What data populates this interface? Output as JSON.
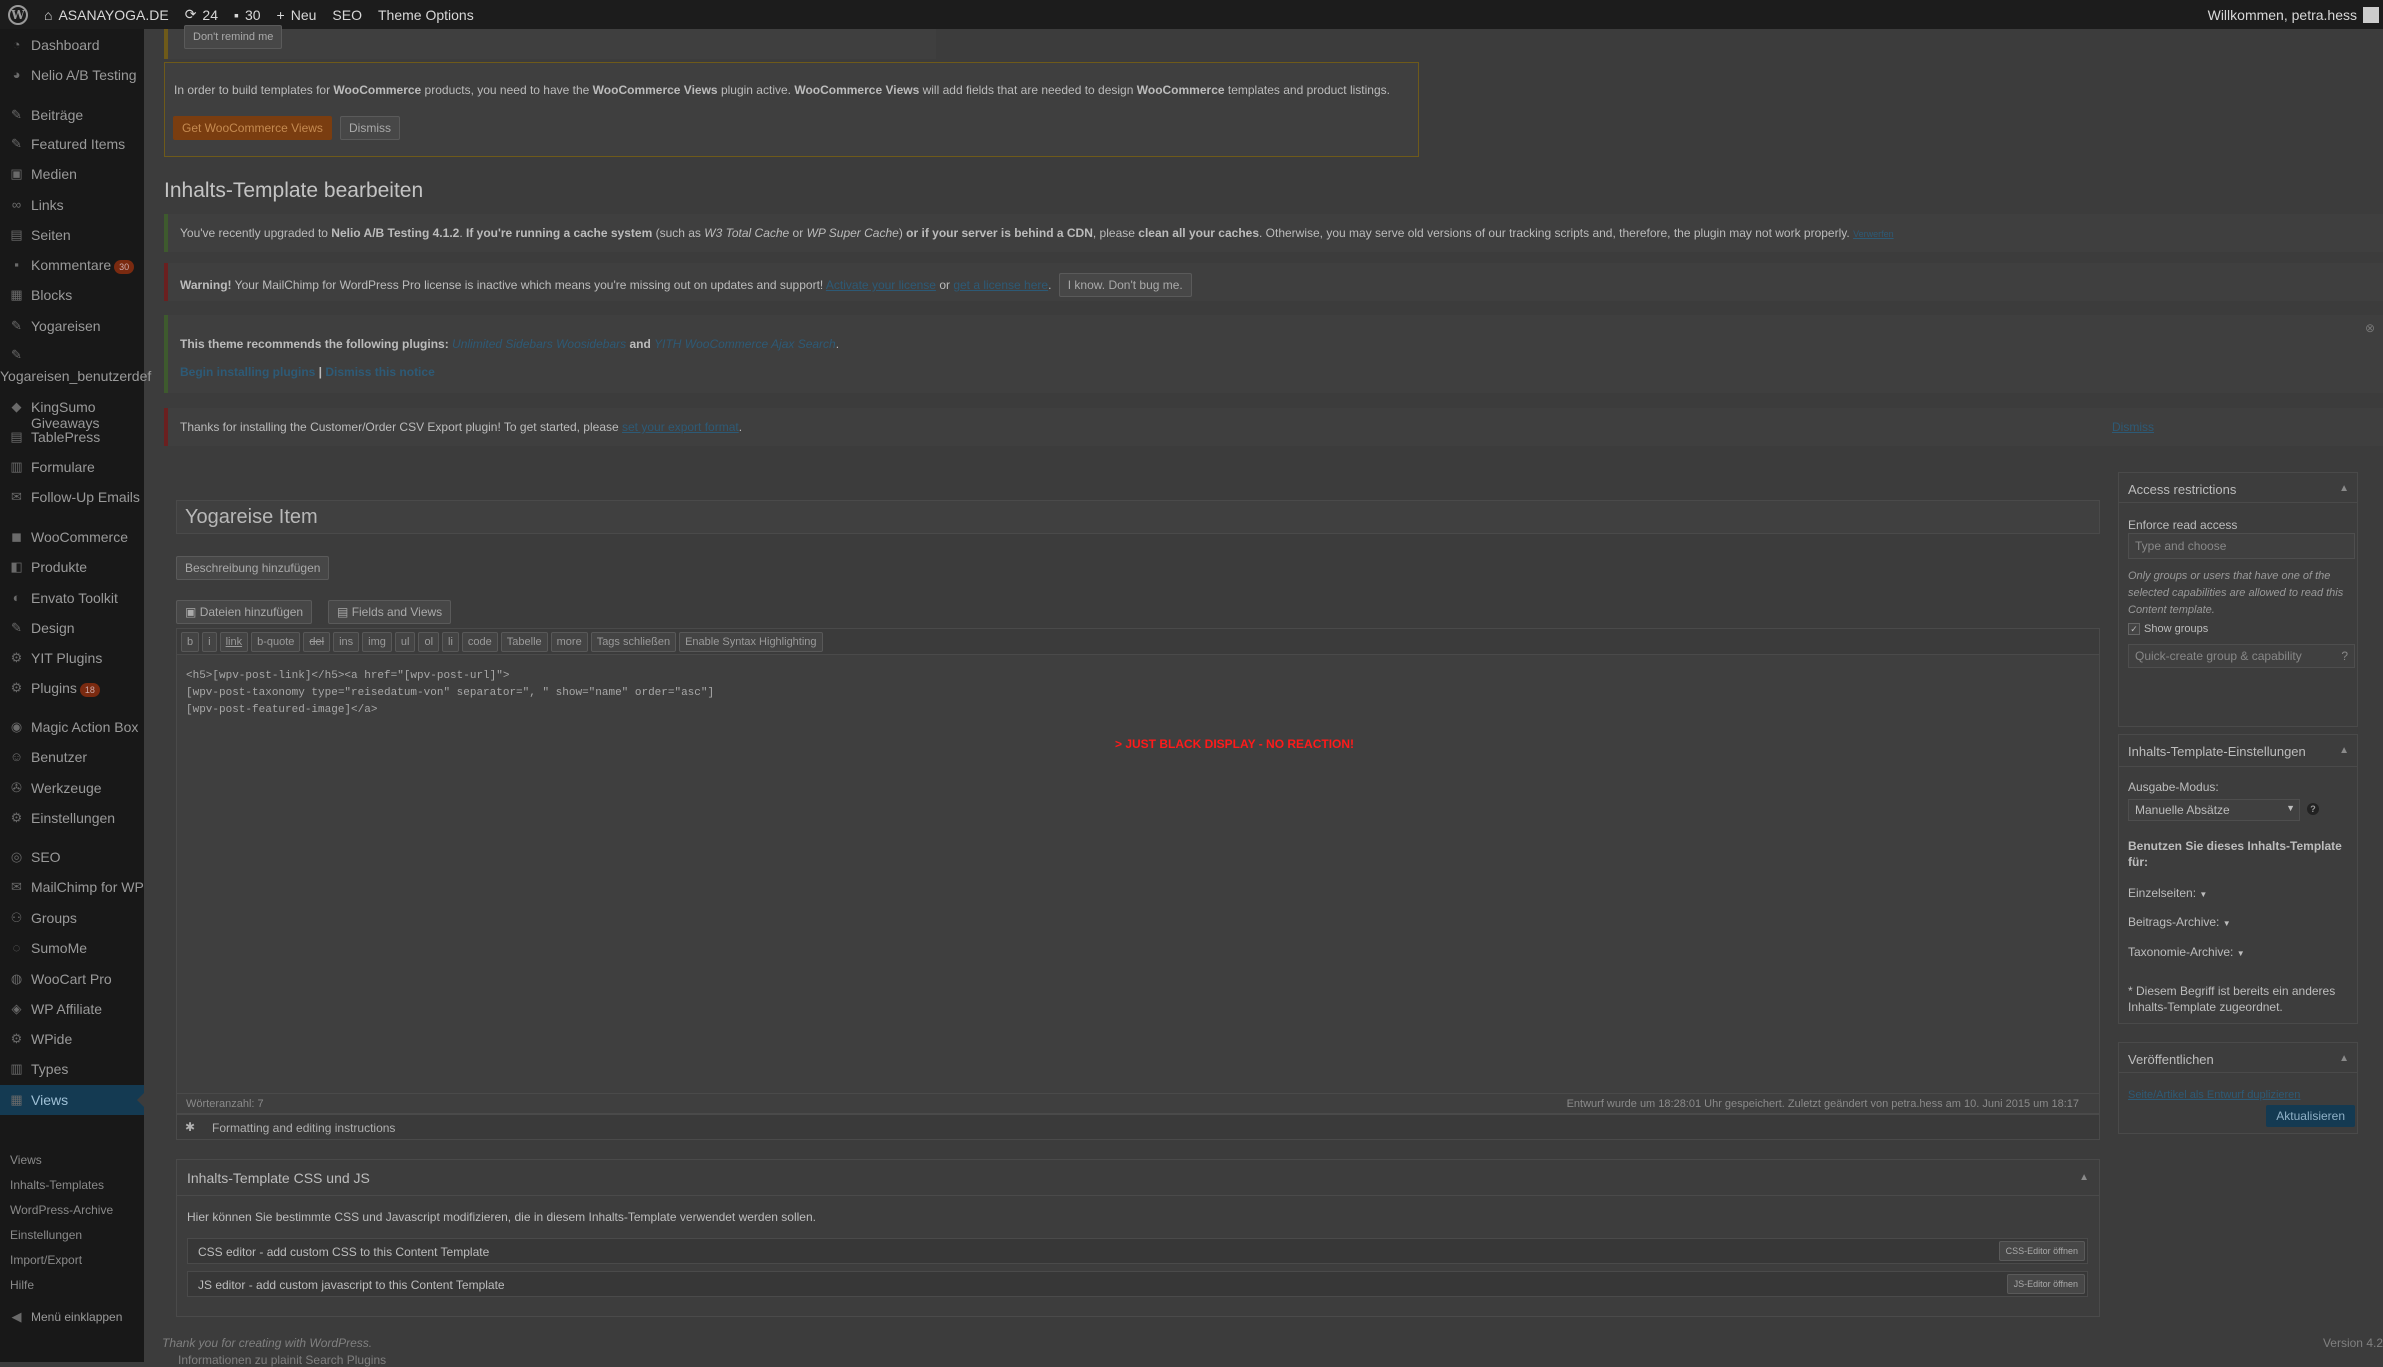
{
  "adminbar": {
    "site_name": "ASANAYOGA.DE",
    "updates_count": "24",
    "comments_count": "30",
    "new_label": "Neu",
    "seo_label": "SEO",
    "theme_options_label": "Theme Options",
    "greeting": "Willkommen, petra.hess"
  },
  "sidebar": {
    "items": [
      {
        "label": "Dashboard",
        "icon": "dashboard-icon"
      },
      {
        "label": "Nelio A/B Testing",
        "icon": "nelio-icon"
      },
      {
        "label": "Beiträge",
        "icon": "pin-icon"
      },
      {
        "label": "Featured Items",
        "icon": "pin-icon"
      },
      {
        "label": "Medien",
        "icon": "media-icon"
      },
      {
        "label": "Links",
        "icon": "link-icon"
      },
      {
        "label": "Seiten",
        "icon": "page-icon"
      },
      {
        "label": "Kommentare",
        "icon": "comment-icon",
        "count": "30"
      },
      {
        "label": "Blocks",
        "icon": "block-icon"
      },
      {
        "label": "Yogareisen",
        "icon": "pin-icon"
      },
      {
        "label": "Yogareisen_benutzerdef",
        "icon": "pin-icon"
      },
      {
        "label": "KingSumo Giveaways",
        "icon": "gift-icon"
      },
      {
        "label": "TablePress",
        "icon": "table-icon"
      },
      {
        "label": "Formulare",
        "icon": "form-icon"
      },
      {
        "label": "Follow-Up Emails",
        "icon": "mail-icon"
      },
      {
        "label": "WooCommerce",
        "icon": "woo-icon"
      },
      {
        "label": "Produkte",
        "icon": "product-icon"
      },
      {
        "label": "Envato Toolkit",
        "icon": "envato-icon"
      },
      {
        "label": "Design",
        "icon": "brush-icon"
      },
      {
        "label": "YIT Plugins",
        "icon": "plugin-icon"
      },
      {
        "label": "Plugins",
        "icon": "plugin-icon",
        "count": "18"
      },
      {
        "label": "Magic Action Box",
        "icon": "box-icon"
      },
      {
        "label": "Benutzer",
        "icon": "user-icon"
      },
      {
        "label": "Werkzeuge",
        "icon": "wrench-icon"
      },
      {
        "label": "Einstellungen",
        "icon": "settings-icon"
      },
      {
        "label": "SEO",
        "icon": "seo-icon"
      },
      {
        "label": "MailChimp for WP",
        "icon": "mailchimp-icon"
      },
      {
        "label": "Groups",
        "icon": "groups-icon"
      },
      {
        "label": "SumoMe",
        "icon": "sumome-icon"
      },
      {
        "label": "WooCart Pro",
        "icon": "cart-icon"
      },
      {
        "label": "WP Affiliate",
        "icon": "affiliate-icon"
      },
      {
        "label": "WPide",
        "icon": "code-icon"
      },
      {
        "label": "Types",
        "icon": "types-icon"
      },
      {
        "label": "Views",
        "icon": "views-icon"
      }
    ],
    "submenu": [
      "Views",
      "Inhalts-Templates",
      "WordPress-Archive",
      "Einstellungen",
      "Import/Export",
      "Hilfe"
    ],
    "collapse_label": "Menü einklappen"
  },
  "notices": {
    "remind": "Don't remind me",
    "woo": {
      "text_1": "In order to build templates for ",
      "woo_a": "WooCommerce",
      "text_2": " products, you need to have the ",
      "views_a": "WooCommerce Views",
      "text_3": " plugin active.  ",
      "views_b": "WooCommerce Views",
      "text_4": " will add fields that are needed to design ",
      "woo_b": "WooCommerce",
      "text_5": " templates and product listings.",
      "get_button": "Get WooCommerce Views",
      "dismiss_button": "Dismiss"
    },
    "page_title": "Inhalts-Template bearbeiten",
    "nelio": {
      "t1": "You've recently upgraded to ",
      "b1": "Nelio A/B Testing 4.1.2",
      "t2": ". ",
      "b2": "If you're running a cache system",
      "t3": " (such as ",
      "i1": "W3 Total Cache",
      "t4": " or ",
      "i2": "WP Super Cache",
      "t5": ") ",
      "b3": "or if your server is behind a CDN",
      "t6": ", please ",
      "b4": "clean all your caches",
      "t7": ". Otherwise, you may serve old versions of our tracking scripts and, therefore, the plugin may not work properly.",
      "dismiss": "Verwerfen"
    },
    "mailchimp": {
      "warning": "Warning!",
      "t1": " Your MailChimp for WordPress Pro license is inactive which means you're missing out on updates and support! ",
      "activate": "Activate your license",
      "t2": " or ",
      "get": "get a license here",
      "t3": ".",
      "button": "I know. Don't bug me."
    },
    "theme": {
      "t1": "This theme recommends the following plugins: ",
      "p1": "Unlimited Sidebars Woosidebars",
      "t2": " and ",
      "p2": "YITH WooCommerce Ajax Search",
      "t3": ".",
      "begin": "Begin installing plugins",
      "sep": " | ",
      "dismiss": "Dismiss this notice"
    },
    "csv": {
      "t1": "Thanks for installing the Customer/Order CSV Export plugin! To get started, please ",
      "link": "set your export format",
      "t2": ".",
      "dismiss": "Dismiss"
    }
  },
  "editor": {
    "title_value": "Yogareise Item",
    "description_button": "Beschreibung hinzufügen",
    "media_button": "Dateien hinzufügen",
    "fields_button": "Fields and Views",
    "quicktags": [
      "b",
      "i",
      "link",
      "b-quote",
      "del",
      "ins",
      "img",
      "ul",
      "ol",
      "li",
      "code",
      "Tabelle",
      "more",
      "Tags schließen",
      "Enable Syntax Highlighting"
    ],
    "code_lines": [
      "<h5>[wpv-post-link]</h5><a href=\"[wpv-post-url]\">",
      "",
      "[wpv-post-taxonomy type=\"reisedatum-von\" separator=\", \" show=\"name\" order=\"asc\"]",
      "[wpv-post-featured-image]</a>"
    ],
    "overlay_warning": "> JUST BLACK DISPLAY - NO REACTION!",
    "word_count": "Wörteranzahl: 7",
    "status": "Entwurf wurde um 18:28:01 Uhr gespeichert. Zuletzt geändert von petra.hess am 10. Juni 2015 um 18:17",
    "formatting": "Formatting and editing instructions"
  },
  "css_js": {
    "title": "Inhalts-Template CSS und JS",
    "desc": "Hier können Sie bestimmte CSS und Javascript modifizieren, die in diesem Inhalts-Template verwendet werden sollen.",
    "css_label": "CSS editor - add custom CSS to this Content Template",
    "css_button": "CSS-Editor öffnen",
    "js_label": "JS editor - add custom javascript to this Content Template",
    "js_button": "JS-Editor öffnen"
  },
  "access": {
    "title": "Access restrictions",
    "enforce": "Enforce read access",
    "placeholder": "Type and choose",
    "desc": "Only groups or users that have one of the selected capabilities are allowed to read this Content template.",
    "show_groups": "Show groups",
    "quick_create": "Quick-create group & capability",
    "help": "?"
  },
  "template_settings": {
    "title": "Inhalts-Template-Einstellungen",
    "mode_label": "Ausgabe-Modus:",
    "mode_value": "Manuelle Absätze",
    "help": "?",
    "use_for": "Benutzen Sie dieses Inhalts-Template für:",
    "single": "Einzelseiten:",
    "archives": "Beitrags-Archive:",
    "taxonomy": "Taxonomie-Archive:",
    "note": "* Diesem Begriff ist bereits ein anderes Inhalts-Template zugeordnet."
  },
  "publish": {
    "title": "Veröffentlichen",
    "duplicate": "Seite/Artikel als Entwurf duplizieren",
    "update": "Aktualisieren"
  },
  "footer": {
    "thanks": "Thank you for creating with WordPress.",
    "info": "Informationen zu plainit Search Plugins",
    "version": "Version 4.2"
  },
  "colors": {
    "accent": "#143a52",
    "warning_red": "#ff1a1a",
    "orange": "#7a3d10"
  }
}
